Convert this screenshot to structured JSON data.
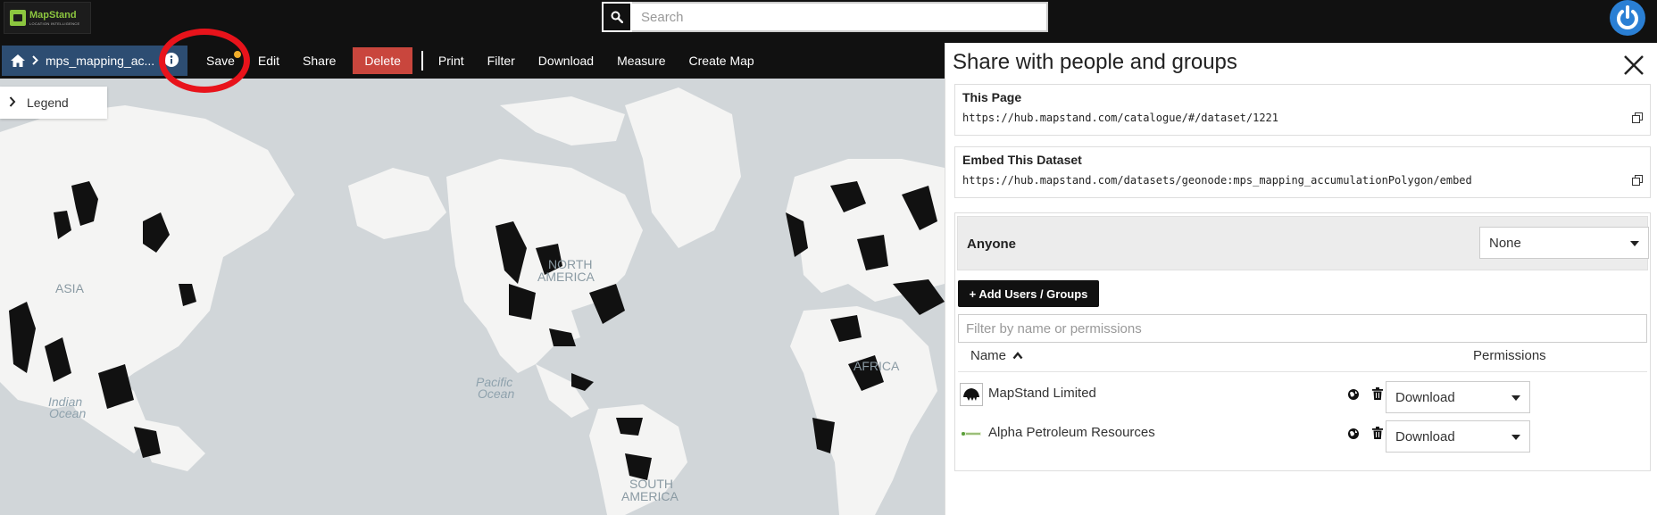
{
  "header": {
    "logo_name": "MapStand",
    "logo_tagline": "LOCATION INTELLIGENCE",
    "search_placeholder": "Search"
  },
  "toolbar": {
    "dataset_title": "mps_mapping_ac...",
    "buttons": {
      "save": "Save",
      "edit": "Edit",
      "share": "Share",
      "delete": "Delete",
      "print": "Print",
      "filter": "Filter",
      "download": "Download",
      "measure": "Measure",
      "create_map": "Create Map"
    },
    "colors": {
      "breadcrumb": "#2d4d72",
      "delete": "#c9463d",
      "unsaved_dot": "#f0ad2a",
      "annotation": "#e8131b"
    }
  },
  "map": {
    "legend_label": "Legend",
    "labels": {
      "asia": "ASIA",
      "north_america_1": "NORTH",
      "north_america_2": "AMERICA",
      "pacific_1": "Pacific",
      "pacific_2": "Ocean",
      "indian_1": "Indian",
      "indian_2": "Ocean",
      "africa": "AFRICA",
      "south_america_1": "SOUTH",
      "south_america_2": "AMERICA"
    }
  },
  "share_panel": {
    "title": "Share with people and groups",
    "this_page": {
      "label": "This Page",
      "url": "https://hub.mapstand.com/catalogue/#/dataset/1221"
    },
    "embed": {
      "label": "Embed This Dataset",
      "url": "https://hub.mapstand.com/datasets/geonode:mps_mapping_accumulationPolygon/embed"
    },
    "anyone": {
      "label": "Anyone",
      "permission": "None"
    },
    "add_button": "+ Add Users / Groups",
    "filter_placeholder": "Filter by name or permissions",
    "columns": {
      "name": "Name",
      "permissions": "Permissions"
    },
    "rows": [
      {
        "name": "MapStand Limited",
        "permission": "Download"
      },
      {
        "name": "Alpha Petroleum Resources",
        "permission": "Download"
      }
    ]
  }
}
